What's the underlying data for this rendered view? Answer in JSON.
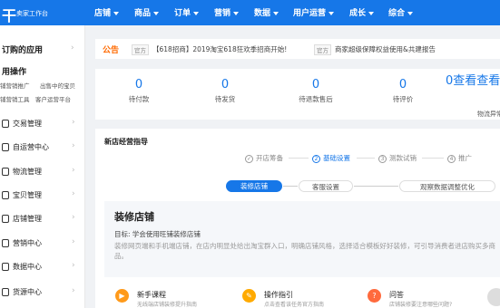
{
  "topbar": {
    "logo": "干",
    "subtitle": "卖家工作台",
    "nav": [
      {
        "label": "店铺"
      },
      {
        "label": "商品"
      },
      {
        "label": "订单"
      },
      {
        "label": "营销"
      },
      {
        "label": "数据"
      },
      {
        "label": "用户运营"
      },
      {
        "label": "成长"
      },
      {
        "label": "综合"
      }
    ]
  },
  "sidebar": {
    "apps_title": "订购的应用",
    "ops_title": "用操作",
    "quick_links": [
      "铺营销推广",
      "出售中的宝贝",
      "铺营销工具",
      "客户运营平台"
    ],
    "items": [
      {
        "label": "交易管理"
      },
      {
        "label": "自运营中心"
      },
      {
        "label": "物流管理"
      },
      {
        "label": "宝贝管理"
      },
      {
        "label": "店铺管理"
      },
      {
        "label": "营销中心"
      },
      {
        "label": "数据中心"
      },
      {
        "label": "货源中心"
      }
    ]
  },
  "notice": {
    "title": "公告",
    "items": [
      {
        "tag": "官方",
        "text": "【618招商】2019淘宝618狂欢季招商开始!"
      },
      {
        "tag": "官方",
        "text": "商家超级保障权益使用&共建报告"
      }
    ]
  },
  "stats": {
    "items": [
      {
        "value": "0",
        "label": "待付款"
      },
      {
        "value": "0",
        "label": "待发货"
      },
      {
        "value": "0",
        "label": "待退款售后"
      },
      {
        "value": "0",
        "label": "待评价"
      }
    ],
    "more_value": "0查看查看",
    "more_sub": "物流异常"
  },
  "guide": {
    "title": "新店经营指导",
    "steps": [
      {
        "num": "1",
        "label": "开店筹备"
      },
      {
        "num": "2",
        "label": "基础设置"
      },
      {
        "num": "3",
        "label": "测款试销"
      },
      {
        "num": "4",
        "label": "推广"
      }
    ],
    "pills": [
      "装修店铺",
      "客服设置",
      "观察数据调整优化"
    ],
    "decorate": {
      "title": "装修店铺",
      "goal": "目标: 学会使用旺铺装修店铺",
      "desc": "装修网页端和手机端店铺，在店内明显处给出淘宝群入口，明确店铺风格，选择适合模板好好装修，可引导消费者进店购买多商品。"
    },
    "cards": [
      {
        "title": "新手课程",
        "sub": "无线端店铺装修提升指南",
        "color": "#ff9a1a",
        "icon": "play-icon"
      },
      {
        "title": "操作指引",
        "sub": "点击查看该任务官方指南",
        "color": "#ffaa00",
        "icon": "guide-icon"
      },
      {
        "title": "问答",
        "sub": "店铺装修要注意哪些问题?",
        "color": "#ff6a3d",
        "icon": "question-icon"
      }
    ]
  }
}
